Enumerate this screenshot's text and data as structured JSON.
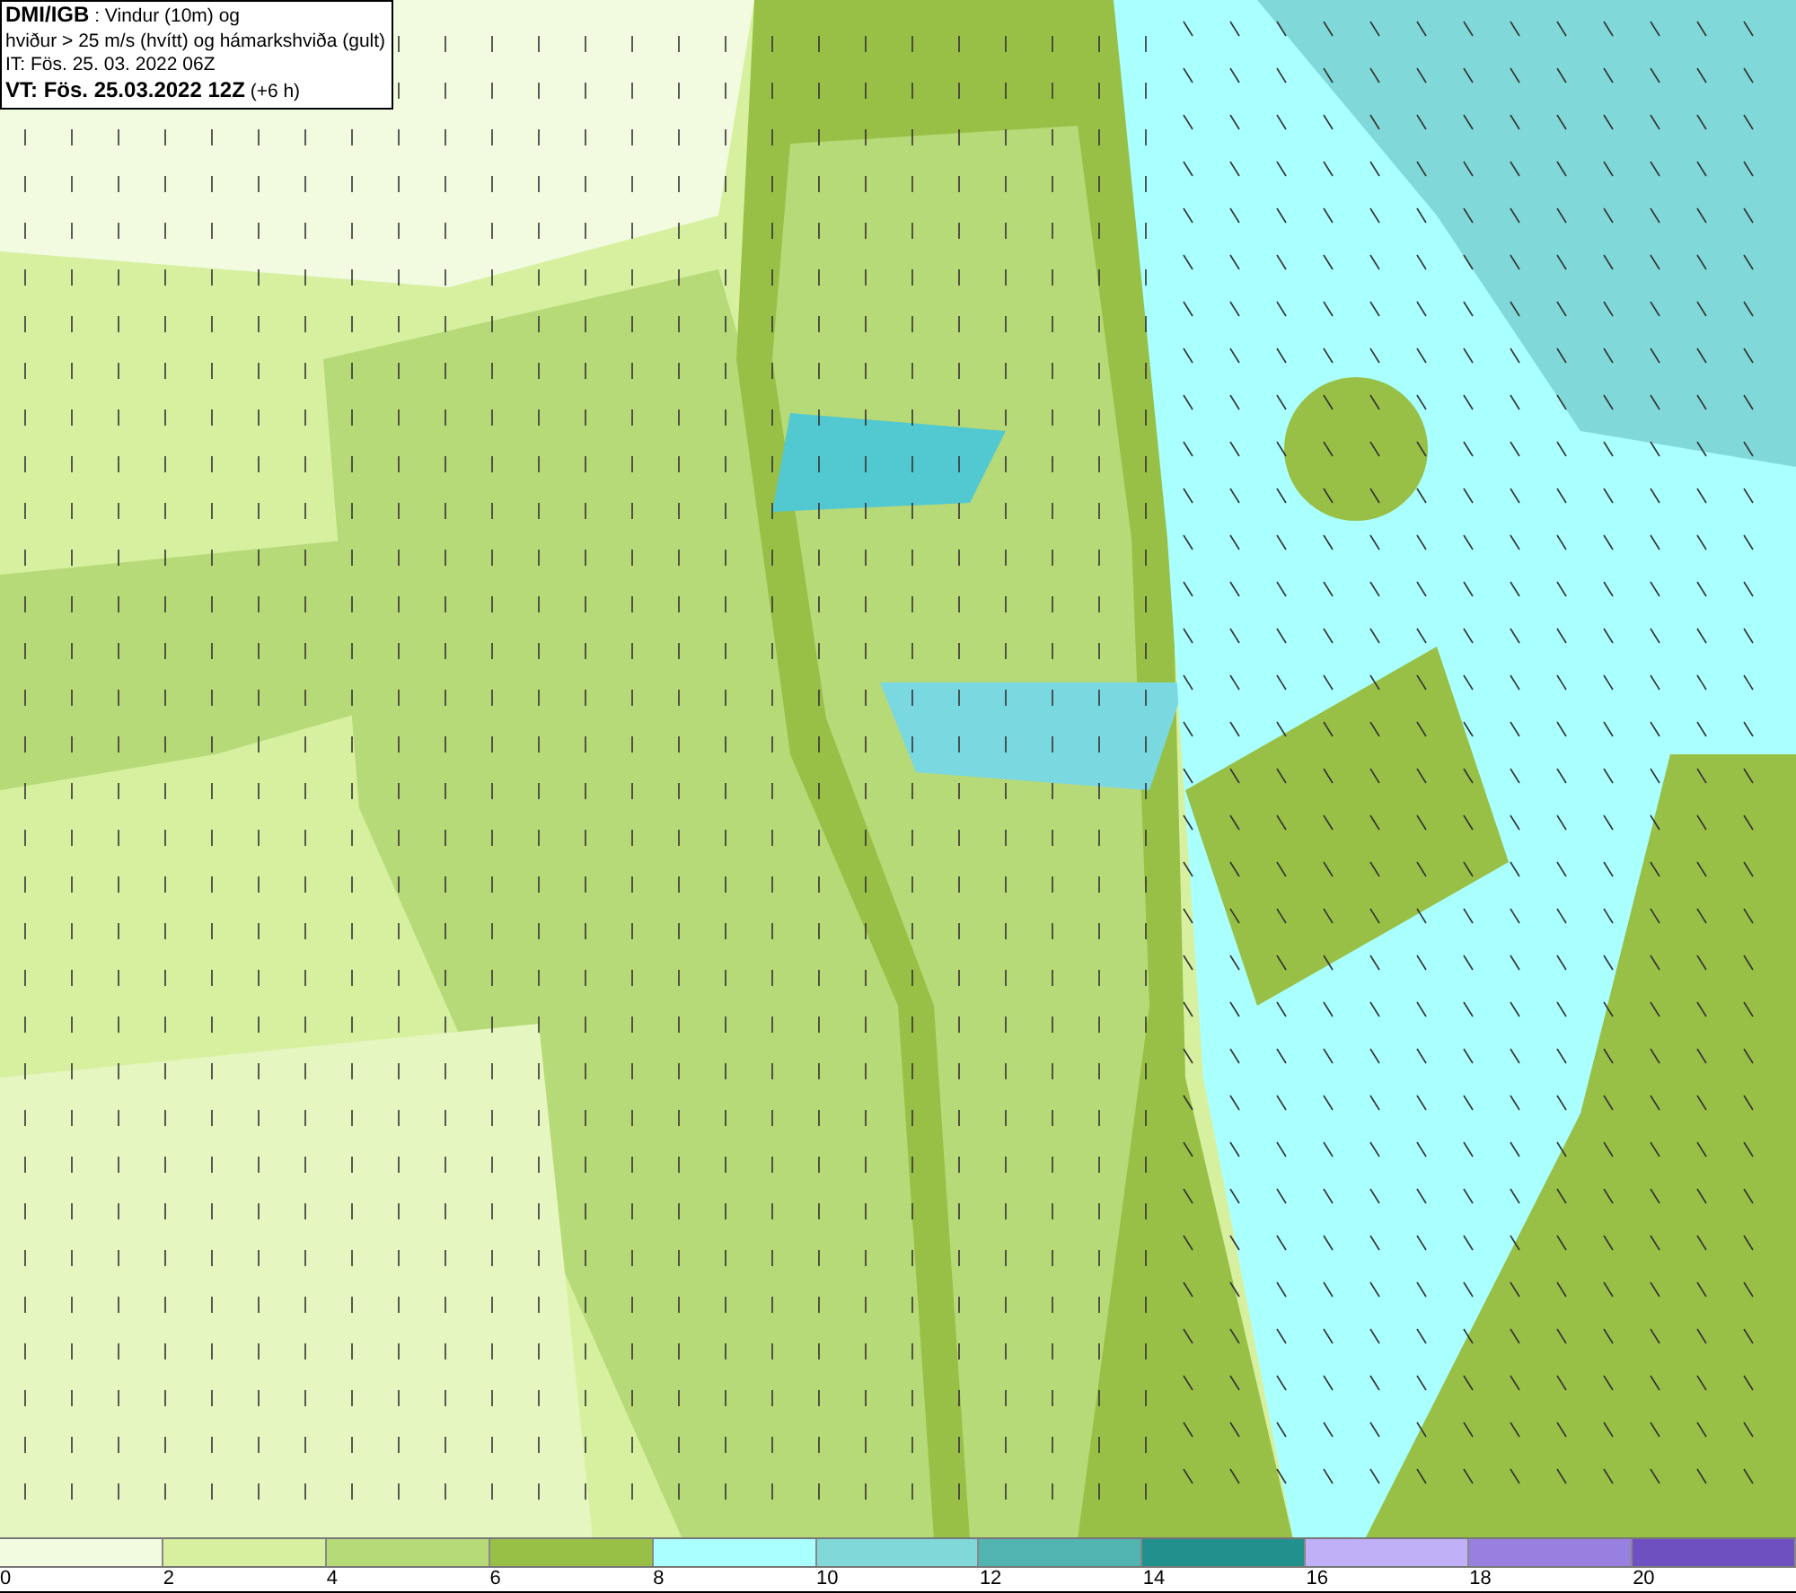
{
  "title_box": {
    "lines": [
      "**DMI/IGB** : Vindur (10m) og",
      "hviður > 25 m/s (hvítt) og hámarkshviða (gult)",
      "IT: Fös. 25. 03. 2022 06Z",
      "**VT: Fös. 25.03.2022 12Z** (+6 h)"
    ]
  },
  "legend": [
    {
      "color": "#f2fbe0",
      "label": "0"
    },
    {
      "color": "#d6f0a0",
      "label": "2"
    },
    {
      "color": "#b7da78",
      "label": "4"
    },
    {
      "color": "#98c046",
      "label": "6"
    },
    {
      "color": "#aaffff",
      "label": "8"
    },
    {
      "color": "#80d8d8",
      "label": "10"
    },
    {
      "color": "#52b4b0",
      "label": "12"
    },
    {
      "color": "#22908c",
      "label": "14"
    },
    {
      "color": "#c0b0f8",
      "label": "16"
    },
    {
      "color": "#9880e0",
      "label": "18"
    },
    {
      "color": "#6e50c0",
      "label": "20"
    }
  ]
}
